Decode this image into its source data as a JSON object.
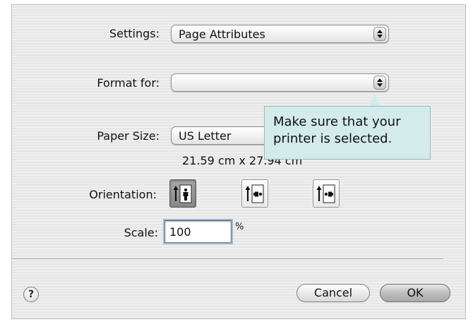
{
  "settings": {
    "label": "Settings:",
    "value": "Page Attributes"
  },
  "format_for": {
    "label": "Format for:",
    "value": ""
  },
  "paper_size": {
    "label": "Paper Size:",
    "value": "US Letter",
    "dimensions": "21.59 cm x 27.94 cm"
  },
  "orientation": {
    "label": "Orientation:",
    "options": [
      {
        "icon": "portrait-orientation-icon",
        "selected": true
      },
      {
        "icon": "landscape-left-orientation-icon",
        "selected": false
      },
      {
        "icon": "landscape-right-orientation-icon",
        "selected": false
      }
    ]
  },
  "scale": {
    "label": "Scale:",
    "value": "100",
    "unit": "%"
  },
  "buttons": {
    "help": "?",
    "cancel": "Cancel",
    "ok": "OK"
  },
  "callout": {
    "line1": "Make sure that your",
    "line2": "printer is selected."
  },
  "colors": {
    "callout_bg": "#d3ebeb",
    "selected_orientation": "#8a8a8a"
  }
}
